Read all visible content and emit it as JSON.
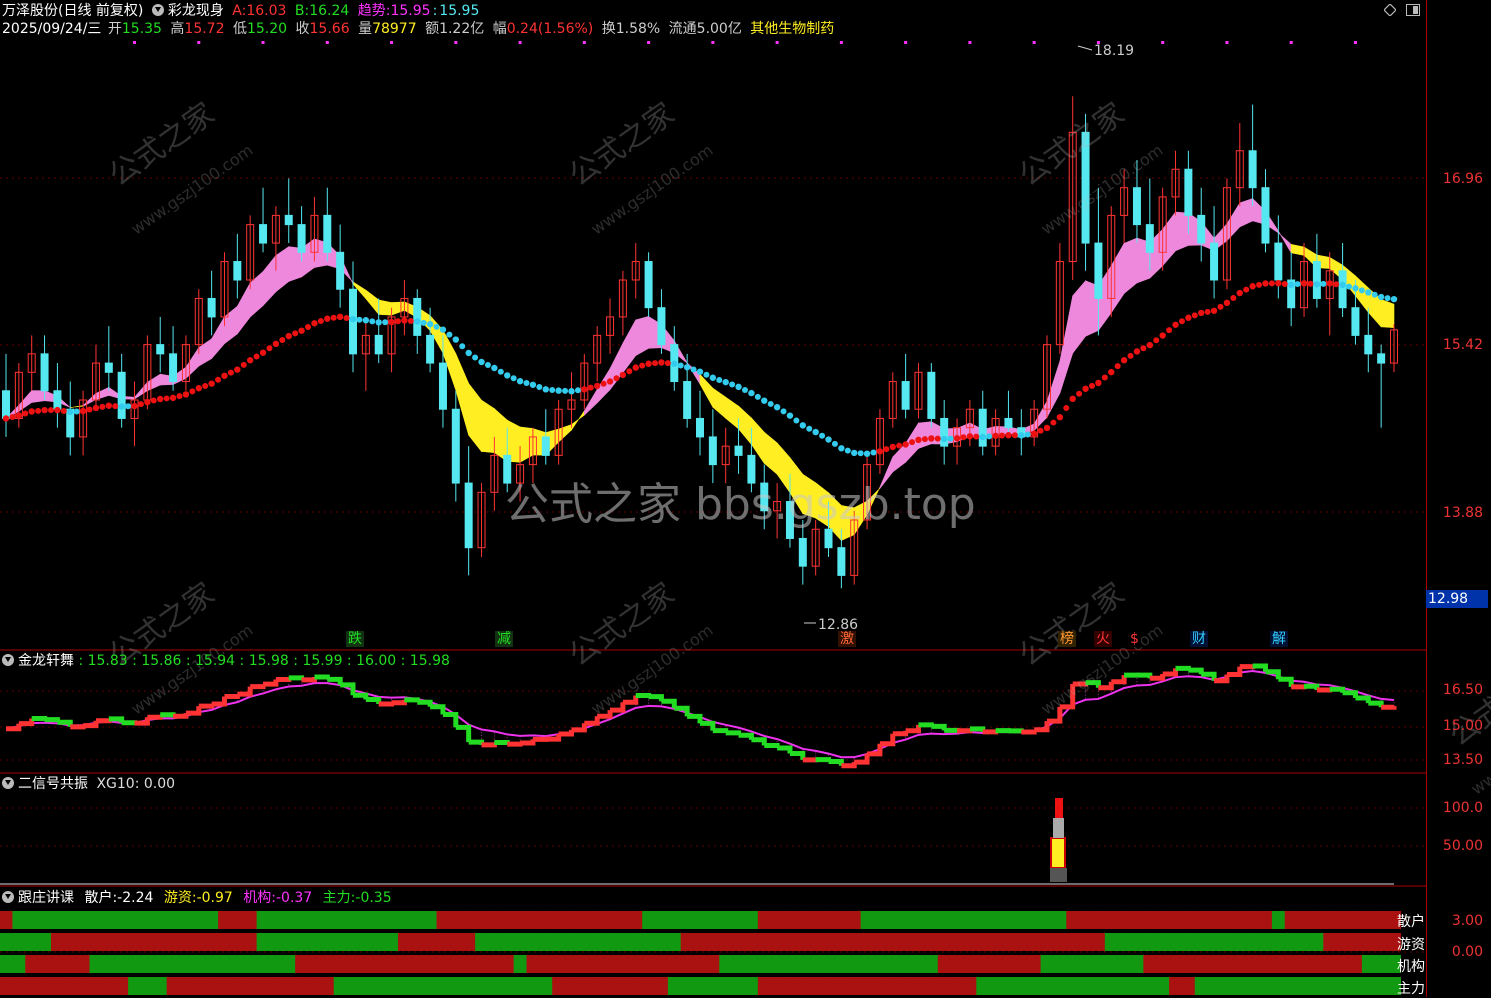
{
  "header": {
    "stock": "万泽股份(日线 前复权)",
    "indicator": "彩龙现身",
    "a_label": "A:",
    "a_value": "16.03",
    "b_label": "B:",
    "b_value": "16.24",
    "trend_label": "趋势:",
    "trend_value": "15.95",
    "trend_sep": ":",
    "trend_value2": "15.95",
    "date": "2025/09/24/三",
    "open_label": "开",
    "open": "15.35",
    "high_label": "高",
    "high": "15.72",
    "low_label": "低",
    "low": "15.20",
    "close_label": "收",
    "close": "15.66",
    "vol_label": "量",
    "vol": "78977",
    "amt_label": "额",
    "amt": "1.22亿",
    "chg_label": "幅",
    "chg": "0.24(1.56%)",
    "turn_label": "换",
    "turn": "1.58%",
    "float_label": "流通",
    "float": "5.00亿",
    "sector": "其他生物制药"
  },
  "colors": {
    "up": "#ff3333",
    "down": "#55e8f0",
    "pink": "#ee88dd",
    "yellow": "#ffee22",
    "red_line": "#ee1111",
    "cyan_line": "#33ccee",
    "green": "#22dd22"
  },
  "price_axis": [
    "16.96",
    "15.42",
    "13.88"
  ],
  "price_current": "12.98",
  "annot_high": "18.19",
  "annot_low": "12.86",
  "watermark": "公式之家 bbs.gszb.top",
  "watermark_small": "公式之家",
  "watermark_url": "www.gszj100.com",
  "signals": [
    {
      "text": "跌",
      "x": 354,
      "color": "#22dd22",
      "bg": "#113311"
    },
    {
      "text": "减",
      "x": 503,
      "color": "#22dd22",
      "bg": "#113311"
    },
    {
      "text": "激",
      "x": 846,
      "color": "#ff6633",
      "bg": "#331100"
    },
    {
      "text": "榜",
      "x": 1066,
      "color": "#ff9933",
      "bg": "#332200"
    },
    {
      "text": "火",
      "x": 1102,
      "color": "#ff3333",
      "bg": "#330000"
    },
    {
      "text": "$",
      "x": 1136,
      "color": "#ff3333",
      "bg": "#000"
    },
    {
      "text": "财",
      "x": 1198,
      "color": "#33ccff",
      "bg": "#001133"
    },
    {
      "text": "解",
      "x": 1278,
      "color": "#33ccff",
      "bg": "#001133"
    }
  ],
  "pane2": {
    "title": "金龙轩舞",
    "values": ": 15.83 : 15.86 : 15.94 : 15.98 : 15.99 : 16.00 : 15.98",
    "axis": [
      "16.50",
      "15.00",
      "13.50"
    ]
  },
  "pane3": {
    "title": "二信号共振",
    "value": "XG10: 0.00",
    "axis": [
      "100.0",
      "50.00"
    ]
  },
  "pane4": {
    "title": "跟庄讲课",
    "retail_label": "散户:",
    "retail": "-2.24",
    "hot_label": "游资:",
    "hot": "-0.97",
    "inst_label": "机构:",
    "inst": "-0.37",
    "main_label": "主力:",
    "main": "-0.35",
    "axis": [
      "3.00",
      "0.00"
    ],
    "rows": [
      "散户",
      "游资",
      "机构",
      "主力"
    ]
  },
  "chart_data": {
    "type": "candlestick",
    "note": "daily candles with ribbon overlays",
    "y_range": [
      12.3,
      18.8
    ],
    "ohlc": [
      [
        15.0,
        15.4,
        14.5,
        14.7
      ],
      [
        14.7,
        15.3,
        14.6,
        15.2
      ],
      [
        15.2,
        15.6,
        15.0,
        15.4
      ],
      [
        15.4,
        15.6,
        14.9,
        15.0
      ],
      [
        15.0,
        15.3,
        14.6,
        14.8
      ],
      [
        14.8,
        15.1,
        14.3,
        14.5
      ],
      [
        14.5,
        15.0,
        14.3,
        14.9
      ],
      [
        14.9,
        15.5,
        14.8,
        15.3
      ],
      [
        15.3,
        15.7,
        15.0,
        15.2
      ],
      [
        15.2,
        15.4,
        14.6,
        14.7
      ],
      [
        14.7,
        15.1,
        14.4,
        14.9
      ],
      [
        14.9,
        15.6,
        14.8,
        15.5
      ],
      [
        15.5,
        15.8,
        15.2,
        15.4
      ],
      [
        15.4,
        15.7,
        15.0,
        15.1
      ],
      [
        15.1,
        15.6,
        15.0,
        15.5
      ],
      [
        15.5,
        16.1,
        15.4,
        16.0
      ],
      [
        16.0,
        16.3,
        15.6,
        15.8
      ],
      [
        15.8,
        16.5,
        15.7,
        16.4
      ],
      [
        16.4,
        16.7,
        16.0,
        16.2
      ],
      [
        16.2,
        16.9,
        16.1,
        16.8
      ],
      [
        16.8,
        17.2,
        16.5,
        16.6
      ],
      [
        16.6,
        17.0,
        16.3,
        16.9
      ],
      [
        16.9,
        17.3,
        16.6,
        16.8
      ],
      [
        16.8,
        17.0,
        16.4,
        16.5
      ],
      [
        16.5,
        17.1,
        16.4,
        16.9
      ],
      [
        16.9,
        17.2,
        16.4,
        16.5
      ],
      [
        16.5,
        16.8,
        15.9,
        16.1
      ],
      [
        16.1,
        16.4,
        15.2,
        15.4
      ],
      [
        15.4,
        15.8,
        15.0,
        15.6
      ],
      [
        15.6,
        16.0,
        15.3,
        15.4
      ],
      [
        15.4,
        15.9,
        15.2,
        15.8
      ],
      [
        15.8,
        16.2,
        15.6,
        16.0
      ],
      [
        16.0,
        16.1,
        15.4,
        15.6
      ],
      [
        15.6,
        15.9,
        15.2,
        15.3
      ],
      [
        15.3,
        15.6,
        14.6,
        14.8
      ],
      [
        14.8,
        15.0,
        13.8,
        14.0
      ],
      [
        14.0,
        14.4,
        13.0,
        13.3
      ],
      [
        13.3,
        14.0,
        13.2,
        13.9
      ],
      [
        13.9,
        14.5,
        13.7,
        14.3
      ],
      [
        14.3,
        14.6,
        13.9,
        14.0
      ],
      [
        14.0,
        14.4,
        13.8,
        14.2
      ],
      [
        14.2,
        14.6,
        14.0,
        14.5
      ],
      [
        14.5,
        14.8,
        14.2,
        14.3
      ],
      [
        14.3,
        14.9,
        14.2,
        14.8
      ],
      [
        14.8,
        15.2,
        14.6,
        14.9
      ],
      [
        14.9,
        15.4,
        14.8,
        15.3
      ],
      [
        15.3,
        15.7,
        15.1,
        15.6
      ],
      [
        15.6,
        16.0,
        15.4,
        15.8
      ],
      [
        15.8,
        16.3,
        15.6,
        16.2
      ],
      [
        16.2,
        16.6,
        16.0,
        16.4
      ],
      [
        16.4,
        16.5,
        15.8,
        15.9
      ],
      [
        15.9,
        16.1,
        15.4,
        15.5
      ],
      [
        15.5,
        15.7,
        15.0,
        15.1
      ],
      [
        15.1,
        15.4,
        14.6,
        14.7
      ],
      [
        14.7,
        15.0,
        14.3,
        14.5
      ],
      [
        14.5,
        14.8,
        14.0,
        14.2
      ],
      [
        14.2,
        14.6,
        14.0,
        14.4
      ],
      [
        14.4,
        14.7,
        14.1,
        14.3
      ],
      [
        14.3,
        14.6,
        13.9,
        14.0
      ],
      [
        14.0,
        14.2,
        13.5,
        13.7
      ],
      [
        13.7,
        14.0,
        13.4,
        13.8
      ],
      [
        13.8,
        14.1,
        13.3,
        13.4
      ],
      [
        13.4,
        13.6,
        12.9,
        13.1
      ],
      [
        13.1,
        13.6,
        13.0,
        13.5
      ],
      [
        13.5,
        13.8,
        13.2,
        13.3
      ],
      [
        13.3,
        13.5,
        12.86,
        13.0
      ],
      [
        13.0,
        13.7,
        12.9,
        13.6
      ],
      [
        13.6,
        14.3,
        13.5,
        14.2
      ],
      [
        14.2,
        14.8,
        14.1,
        14.7
      ],
      [
        14.7,
        15.2,
        14.6,
        15.1
      ],
      [
        15.1,
        15.4,
        14.7,
        14.8
      ],
      [
        14.8,
        15.3,
        14.7,
        15.2
      ],
      [
        15.2,
        15.3,
        14.6,
        14.7
      ],
      [
        14.7,
        14.9,
        14.2,
        14.4
      ],
      [
        14.4,
        14.7,
        14.2,
        14.6
      ],
      [
        14.6,
        14.9,
        14.4,
        14.8
      ],
      [
        14.8,
        15.0,
        14.3,
        14.4
      ],
      [
        14.4,
        14.8,
        14.3,
        14.7
      ],
      [
        14.7,
        15.0,
        14.5,
        14.6
      ],
      [
        14.6,
        14.8,
        14.3,
        14.5
      ],
      [
        14.5,
        14.9,
        14.4,
        14.8
      ],
      [
        14.8,
        15.6,
        14.7,
        15.5
      ],
      [
        15.5,
        16.6,
        15.4,
        16.4
      ],
      [
        16.4,
        18.19,
        16.2,
        17.8
      ],
      [
        17.8,
        18.0,
        16.3,
        16.6
      ],
      [
        16.6,
        17.2,
        15.6,
        16.0
      ],
      [
        16.0,
        17.0,
        15.8,
        16.9
      ],
      [
        16.9,
        17.4,
        16.6,
        17.2
      ],
      [
        17.2,
        17.5,
        16.6,
        16.8
      ],
      [
        16.8,
        17.3,
        16.3,
        16.5
      ],
      [
        16.5,
        17.2,
        16.3,
        17.1
      ],
      [
        17.1,
        17.6,
        16.9,
        17.4
      ],
      [
        17.4,
        17.6,
        16.7,
        16.9
      ],
      [
        16.9,
        17.2,
        16.4,
        16.6
      ],
      [
        16.6,
        17.0,
        16.0,
        16.2
      ],
      [
        16.2,
        17.3,
        16.1,
        17.2
      ],
      [
        17.2,
        17.9,
        17.0,
        17.6
      ],
      [
        17.6,
        18.1,
        17.0,
        17.2
      ],
      [
        17.2,
        17.4,
        16.5,
        16.6
      ],
      [
        16.6,
        16.9,
        16.0,
        16.2
      ],
      [
        16.2,
        16.5,
        15.7,
        15.9
      ],
      [
        15.9,
        16.6,
        15.8,
        16.4
      ],
      [
        16.4,
        16.7,
        15.9,
        16.0
      ],
      [
        16.0,
        16.5,
        15.6,
        16.3
      ],
      [
        16.3,
        16.6,
        15.8,
        15.9
      ],
      [
        15.9,
        16.2,
        15.5,
        15.6
      ],
      [
        15.6,
        15.9,
        15.2,
        15.4
      ],
      [
        15.4,
        15.5,
        14.6,
        15.3
      ],
      [
        15.3,
        15.72,
        15.2,
        15.66
      ]
    ],
    "series": [
      {
        "name": "A",
        "values": []
      },
      {
        "name": "B",
        "values": []
      }
    ]
  }
}
